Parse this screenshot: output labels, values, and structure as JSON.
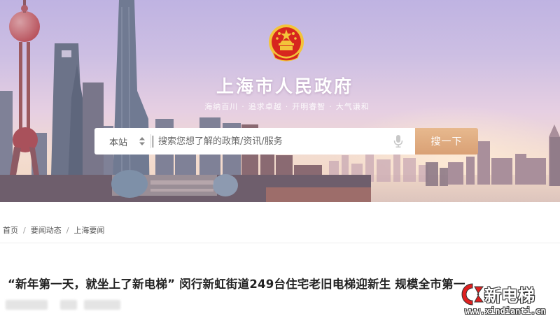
{
  "header": {
    "site_title": "上海市人民政府",
    "slogans": [
      "海纳百川",
      "追求卓越",
      "开明睿智",
      "大气谦和"
    ]
  },
  "search": {
    "scope_value": "本站",
    "placeholder": "搜索您想了解的政策/资讯/服务",
    "button_label": "搜一下"
  },
  "breadcrumb": {
    "items": [
      "首页",
      "要闻动态",
      "上海要闻"
    ],
    "separator": "/"
  },
  "article": {
    "title": "“新年第一天，就坐上了新电梯” 闵行新虹街道249台住宅老旧电梯迎新生 规模全市第一"
  },
  "watermark": {
    "name": "新电梯",
    "url": "www.xindianti.cn"
  },
  "colors": {
    "search_button": "#dba57a",
    "emblem_red": "#d7261e",
    "emblem_gold": "#f3c43a",
    "watermark_red": "#e02020"
  }
}
